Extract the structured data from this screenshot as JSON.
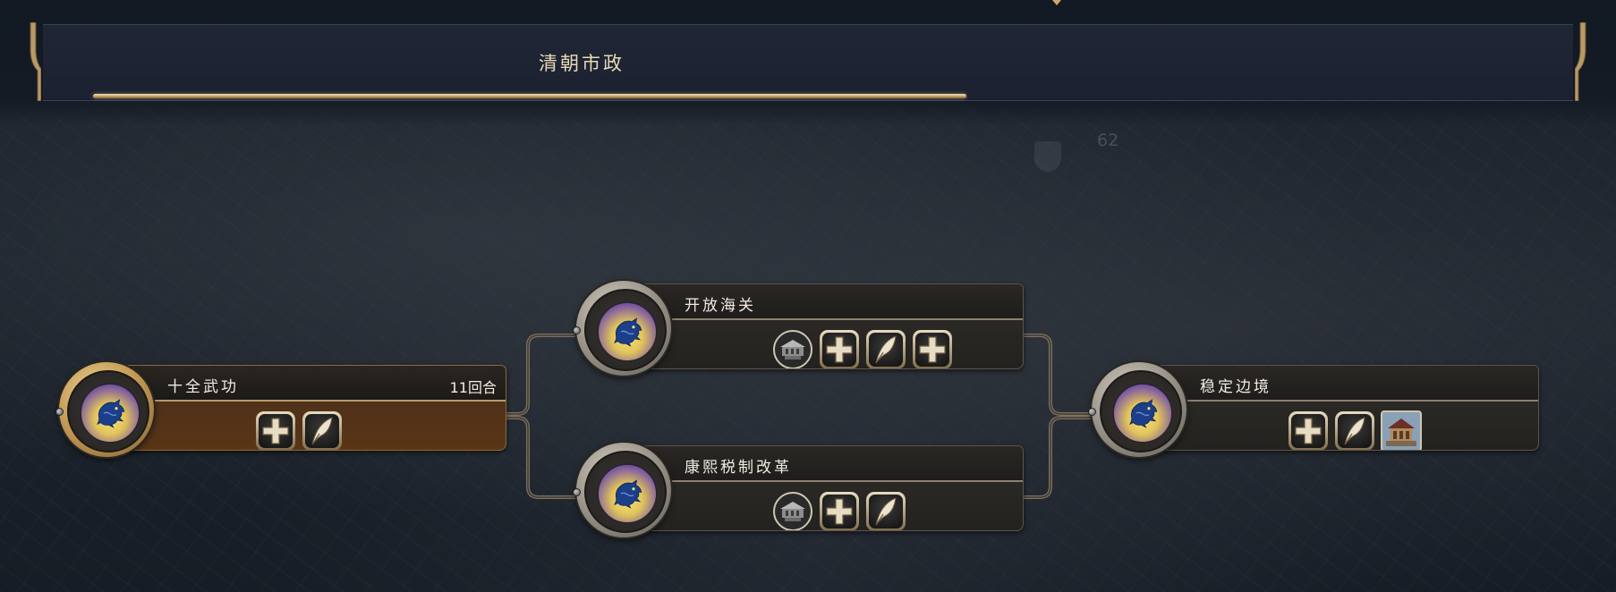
{
  "header": {
    "title": "清朝市政",
    "progress_fraction": 0.61
  },
  "map": {
    "faint_number": "62"
  },
  "policies": [
    {
      "id": "p1",
      "title": "十全武功",
      "turns": "11回合",
      "active": true,
      "emblem": "dragon-emblem-icon",
      "icons": [
        "plus-icon",
        "quill-icon"
      ]
    },
    {
      "id": "p2",
      "title": "开放海关",
      "active": false,
      "emblem": "dragon-emblem-icon",
      "icons": [
        "building-ship-icon",
        "plus-icon",
        "quill-icon",
        "plus-icon"
      ]
    },
    {
      "id": "p3",
      "title": "康熙税制改革",
      "active": false,
      "emblem": "dragon-emblem-icon",
      "icons": [
        "building-ship-icon",
        "plus-icon",
        "quill-icon"
      ]
    },
    {
      "id": "p4",
      "title": "稳定边境",
      "active": false,
      "emblem": "dragon-emblem-icon",
      "icons": [
        "plus-icon",
        "quill-icon",
        "palace-building-icon"
      ]
    }
  ],
  "colors": {
    "accent_gold": "#c9a86a",
    "text_light": "#f1ece2",
    "emblem_yellow": "#e1c35b",
    "emblem_purple": "#5b3f86",
    "dragon_blue": "#1b3f8a"
  }
}
